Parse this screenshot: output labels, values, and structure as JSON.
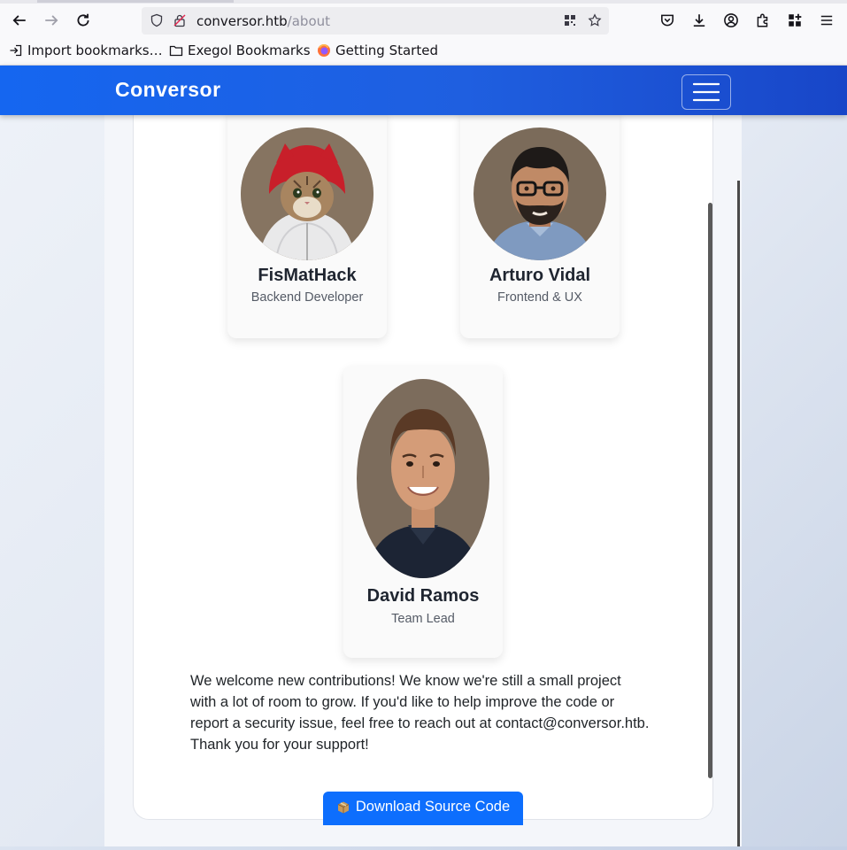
{
  "browser": {
    "url_host": "conversor.htb",
    "url_path": "/about",
    "bookmarks": [
      {
        "label": "Import bookmarks…",
        "icon": "import-icon"
      },
      {
        "label": "Exegol Bookmarks",
        "icon": "folder-icon"
      },
      {
        "label": "Getting Started",
        "icon": "firefox-icon"
      }
    ]
  },
  "navbar": {
    "brand": "Conversor",
    "toggle_icon": "hamburger-icon"
  },
  "team": [
    {
      "name": "FisMatHack",
      "role": "Backend Developer",
      "avatar": "cat-in-red-hoodie"
    },
    {
      "name": "Arturo Vidal",
      "role": "Frontend & UX",
      "avatar": "man-with-glasses"
    },
    {
      "name": "David Ramos",
      "role": "Team Lead",
      "avatar": "smiling-man"
    }
  ],
  "contribution_text": "We welcome new contributions! We know we're still a small project with a lot of room to grow. If you'd like to help improve the code or report a security issue, feel free to reach out at contact@conversor.htb. Thank you for your support!",
  "download_button": {
    "label": "Download Source Code",
    "icon": "package-icon"
  },
  "colors": {
    "navbar": "#1f5fe0",
    "primary_button": "#0d6efd",
    "text": "#212529",
    "muted": "#555b66"
  }
}
